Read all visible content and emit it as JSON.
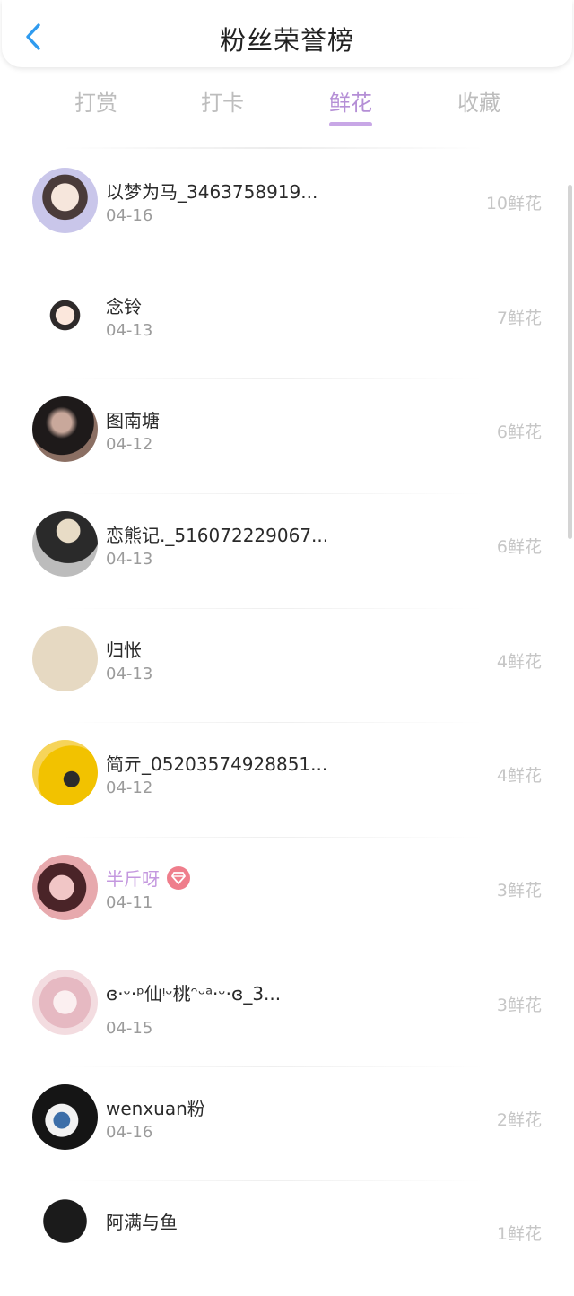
{
  "header": {
    "title": "粉丝荣誉榜",
    "back_icon": "chevron-left-icon"
  },
  "tabs": [
    {
      "label": "打赏",
      "active": false
    },
    {
      "label": "打卡",
      "active": false
    },
    {
      "label": "鲜花",
      "active": true
    },
    {
      "label": "收藏",
      "active": false
    }
  ],
  "colors": {
    "accent": "#b58fd6",
    "back": "#2f9bef",
    "vip_badge": "#ef7e8c"
  },
  "fans": [
    {
      "name": "以梦为马_3463758919...",
      "date": "04-16",
      "amount": "10鲜花"
    },
    {
      "name": "念铃",
      "date": "04-13",
      "amount": "7鲜花"
    },
    {
      "name": "图南塘",
      "date": "04-12",
      "amount": "6鲜花"
    },
    {
      "name": "恋熊记._516072229067...",
      "date": "04-13",
      "amount": "6鲜花"
    },
    {
      "name": "归怅",
      "date": "04-13",
      "amount": "4鲜花"
    },
    {
      "name": "简亓_05203574928851...",
      "date": "04-12",
      "amount": "4鲜花"
    },
    {
      "name": "半斤呀",
      "date": "04-11",
      "amount": "3鲜花",
      "vip": true
    },
    {
      "name": "ɞ·ᵕ·ᵖ仙ᵎᵕ桃ᵔᵕᵃ·ᵕ·ɞ_3...",
      "date": "04-15",
      "amount": "3鲜花"
    },
    {
      "name": "wenxuan粉",
      "date": "04-16",
      "amount": "2鲜花"
    },
    {
      "name": "阿满与鱼",
      "date": "",
      "amount": "1鲜花"
    }
  ]
}
